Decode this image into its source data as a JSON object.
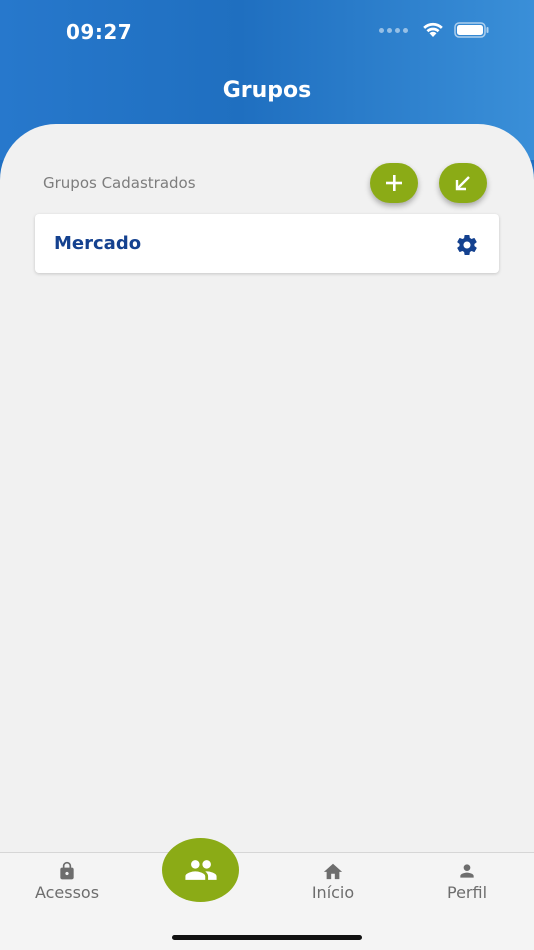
{
  "status_bar": {
    "time": "09:27"
  },
  "header": {
    "title": "Grupos"
  },
  "section": {
    "label": "Grupos Cadastrados"
  },
  "groups": [
    {
      "name": "Mercado"
    }
  ],
  "tabs": [
    {
      "label": "Acessos",
      "icon": "lock-icon"
    },
    {
      "label": "",
      "icon": "group-icon",
      "active": true
    },
    {
      "label": "Início",
      "icon": "home-icon"
    },
    {
      "label": "Perfil",
      "icon": "person-icon"
    }
  ],
  "colors": {
    "header_blue": "#1f6fc2",
    "accent_green": "#8bab16",
    "group_name": "#14418f",
    "background": "#f1f1f1"
  }
}
